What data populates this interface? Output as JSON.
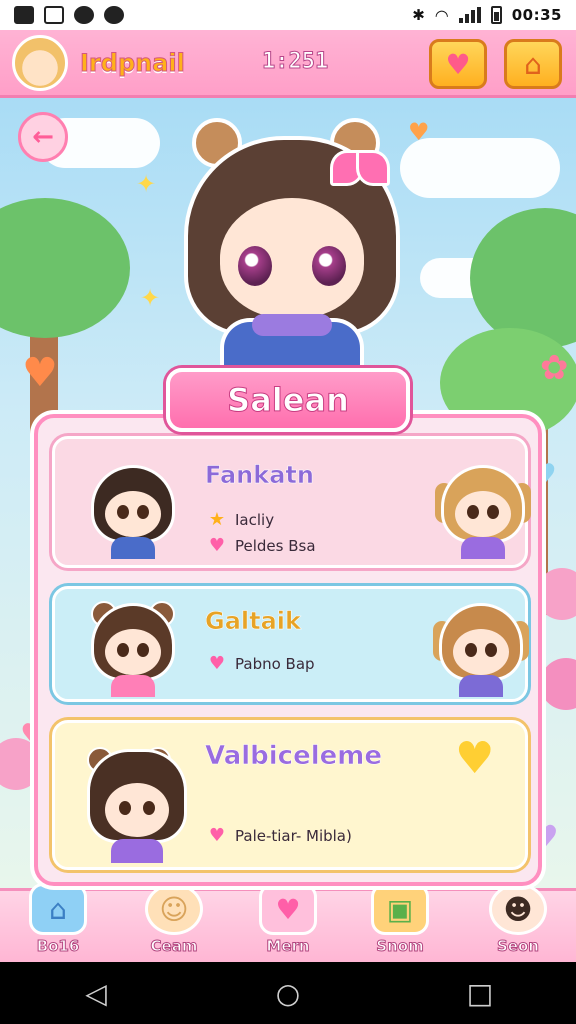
{
  "status_bar": {
    "time": "00:35",
    "icons": [
      "gallery-icon",
      "note-icon",
      "app-icon",
      "clock-icon",
      "bluetooth-icon",
      "wifi-icon",
      "signal-icon",
      "battery-icon"
    ]
  },
  "header": {
    "title": "Irdpnail",
    "timer": "1:251",
    "gift_icon": "heart-gift-icon",
    "home_icon": "home-icon"
  },
  "character": {
    "name": "Salean"
  },
  "cards": [
    {
      "name": "Fankatn",
      "stats": [
        {
          "icon": "star-icon",
          "text": "Iacliy"
        },
        {
          "icon": "heart-icon",
          "text": "Peldes Bsa"
        }
      ]
    },
    {
      "name": "Galtaik",
      "stats": [
        {
          "icon": "heart-icon",
          "text": "Pabno Bap"
        }
      ]
    },
    {
      "name": "Valbiceleme",
      "stats": [
        {
          "icon": "heart-icon",
          "text": "Pale-tiar- Mibla)"
        }
      ]
    }
  ],
  "bottom_nav": [
    {
      "label": "Bo16",
      "icon": "house-icon"
    },
    {
      "label": "Ceam",
      "icon": "character-icon"
    },
    {
      "label": "Mern",
      "icon": "home-heart-icon"
    },
    {
      "label": "Snom",
      "icon": "shop-icon"
    },
    {
      "label": "Seon",
      "icon": "profile-icon"
    }
  ],
  "colors": {
    "header_pink": "#ff9fc8",
    "panel_border": "#ff8fc0",
    "card1_bg": "#fbd9e4",
    "card2_bg": "#cbeef7",
    "card3_bg": "#fff6cf"
  }
}
